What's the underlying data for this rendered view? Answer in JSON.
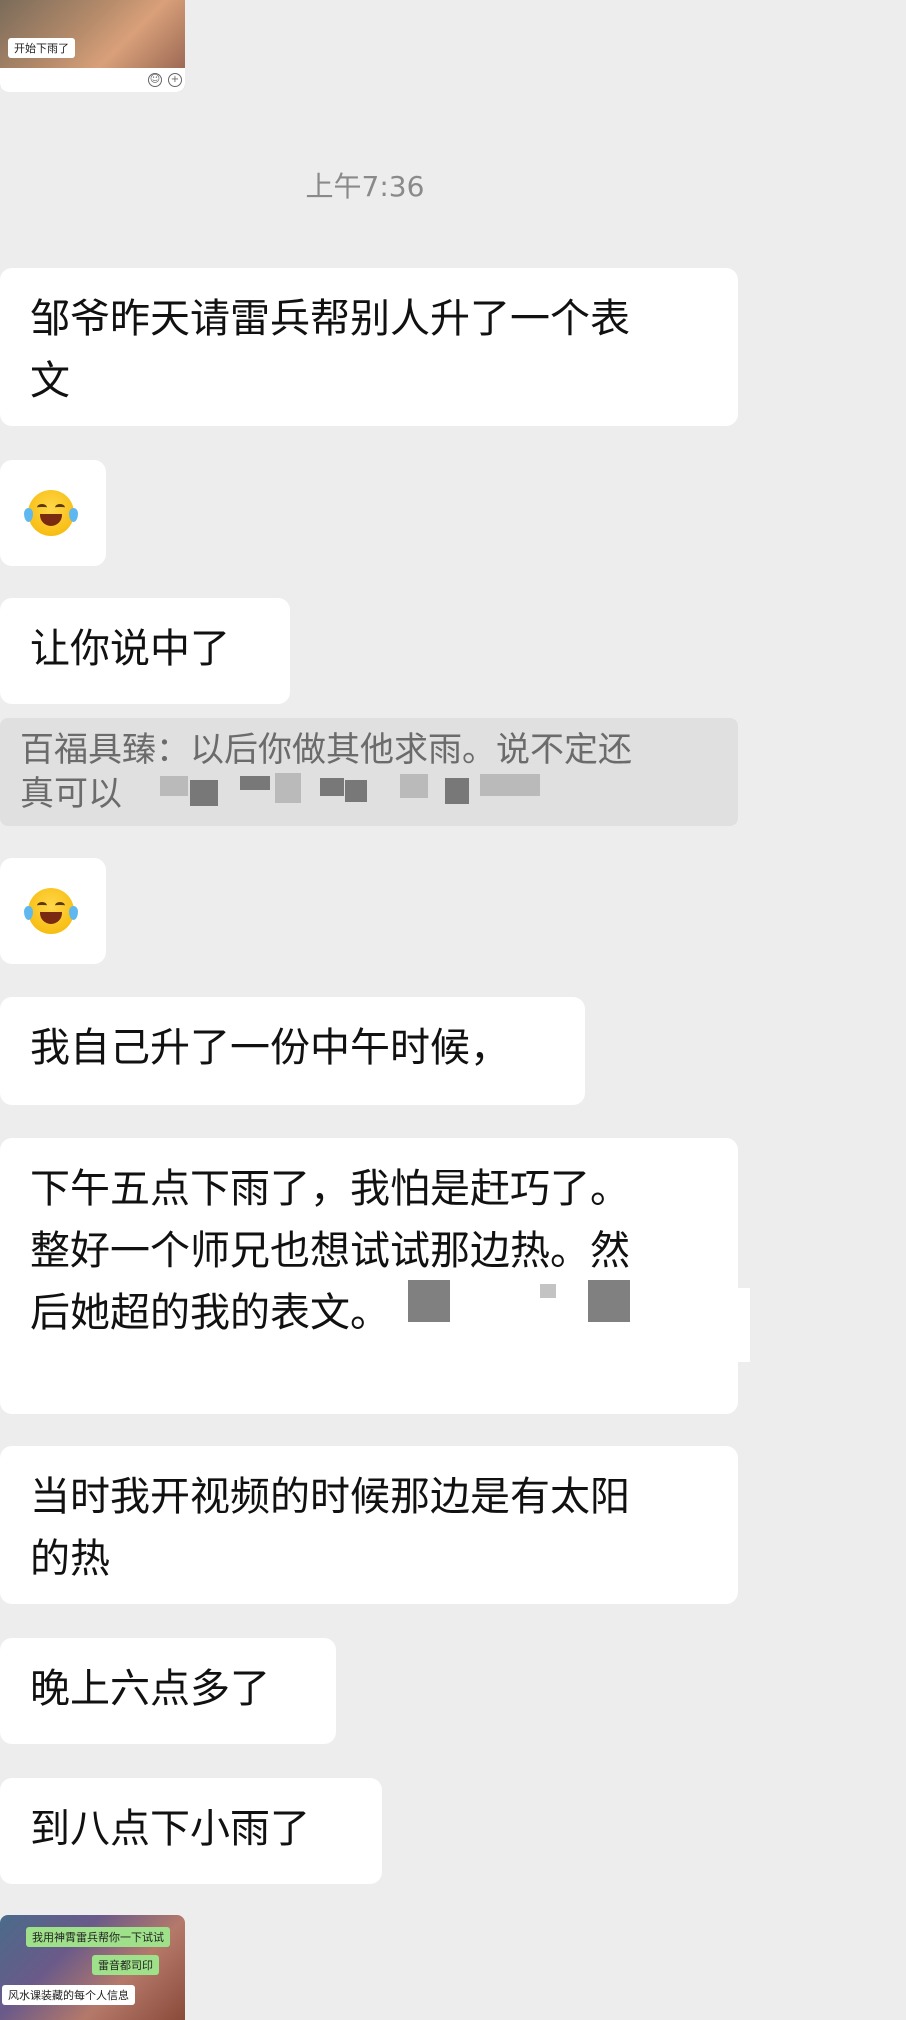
{
  "top_image": {
    "caption": "开始下雨了"
  },
  "timestamp": "上午7:36",
  "messages": {
    "m1": {
      "lines": [
        "邹爷昨天请雷兵帮别人升了一个表",
        "文"
      ]
    },
    "m3": {
      "text": "让你说中了"
    },
    "quote": {
      "lines": [
        "百福具臻：以后你做其他求雨。说不定还",
        "真可以"
      ]
    },
    "m5": {
      "text": "我自己升了一份中午时候，"
    },
    "m6": {
      "lines": [
        "下午五点下雨了，我怕是赶巧了。",
        "整好一个师兄也想试试那边热。然",
        "后她超的我的表文。"
      ]
    },
    "m7": {
      "lines": [
        "当时我开视频的时候那边是有太阳",
        "的热"
      ]
    },
    "m8": {
      "text": "晚上六点多了"
    },
    "m9": {
      "text": "到八点下小雨了"
    }
  },
  "bottom_image": {
    "captions": [
      "我用神霄雷兵帮你一下试试",
      "雷音都司印",
      "风水课装藏的每个人信息"
    ]
  },
  "emoji_names": [
    "face-with-tears-of-joy-icon",
    "face-with-tears-of-joy-icon"
  ],
  "colors": {
    "background": "#ededed",
    "bubble": "#ffffff",
    "quote_bg": "#e0e0e0",
    "timestamp": "#8a8a8a"
  }
}
